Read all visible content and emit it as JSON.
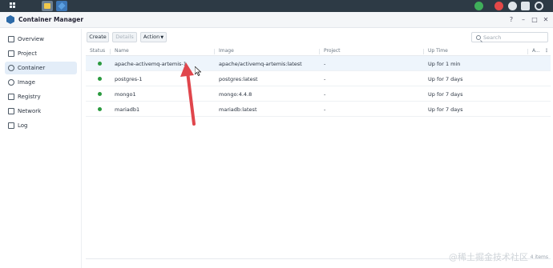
{
  "colors": {
    "accent": "#3d77b7",
    "status_running": "#2b9a3f",
    "arrow": "#e0464c",
    "sidebar_active": "#e3edf8"
  },
  "window": {
    "title": "Container Manager",
    "controls": [
      "?",
      "–",
      "□",
      "✕"
    ]
  },
  "sidebar": {
    "items": [
      {
        "label": "Overview",
        "icon": "overview-icon"
      },
      {
        "label": "Project",
        "icon": "project-icon"
      },
      {
        "label": "Container",
        "icon": "container-icon",
        "active": true
      },
      {
        "label": "Image",
        "icon": "image-icon"
      },
      {
        "label": "Registry",
        "icon": "registry-icon"
      },
      {
        "label": "Network",
        "icon": "network-icon"
      },
      {
        "label": "Log",
        "icon": "log-icon"
      }
    ]
  },
  "toolbar": {
    "create_label": "Create",
    "details_label": "Details",
    "action_label": "Action",
    "search_placeholder": "Search"
  },
  "table": {
    "columns": [
      "Status",
      "Name",
      "Image",
      "Project",
      "Up Time",
      "A..."
    ],
    "rows": [
      {
        "name": "apache-activemq-artemis-1",
        "image": "apache/activemq-artemis:latest",
        "project": "-",
        "uptime": "Up for 1 min"
      },
      {
        "name": "postgres-1",
        "image": "postgres:latest",
        "project": "-",
        "uptime": "Up for 7 days"
      },
      {
        "name": "mongo1",
        "image": "mongo:4.4.8",
        "project": "-",
        "uptime": "Up for 7 days"
      },
      {
        "name": "mariadb1",
        "image": "mariadb:latest",
        "project": "-",
        "uptime": "Up for 7 days"
      }
    ]
  },
  "footer": {
    "item_count": "4 items"
  },
  "watermark": "@稀土掘金技术社区"
}
